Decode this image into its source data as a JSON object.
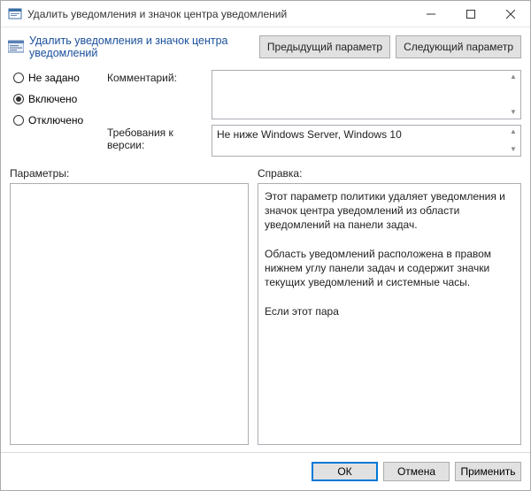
{
  "window": {
    "title": "Удалить уведомления и значок центра уведомлений"
  },
  "header": {
    "subtitle": "Удалить уведомления и значок центра уведомлений",
    "prev": "Предыдущий параметр",
    "next": "Следующий параметр"
  },
  "radios": {
    "not_configured": "Не задано",
    "enabled": "Включено",
    "disabled": "Отключено",
    "selected": "enabled"
  },
  "fields": {
    "comment_label": "Комментарий:",
    "comment_value": "",
    "version_label": "Требования к версии:",
    "version_value": "Не ниже Windows Server, Windows 10"
  },
  "mid": {
    "params_label": "Параметры:",
    "help_label": "Справка:"
  },
  "help_text": "Этот параметр политики удаляет уведомления и значок центра уведомлений из области уведомлений на панели задач.\n\nОбласть уведомлений расположена в правом нижнем углу панели задач и содержит значки текущих уведомлений и системные часы.\n\nЕсли этот пара",
  "footer": {
    "ok": "ОК",
    "cancel": "Отмена",
    "apply": "Применить"
  }
}
